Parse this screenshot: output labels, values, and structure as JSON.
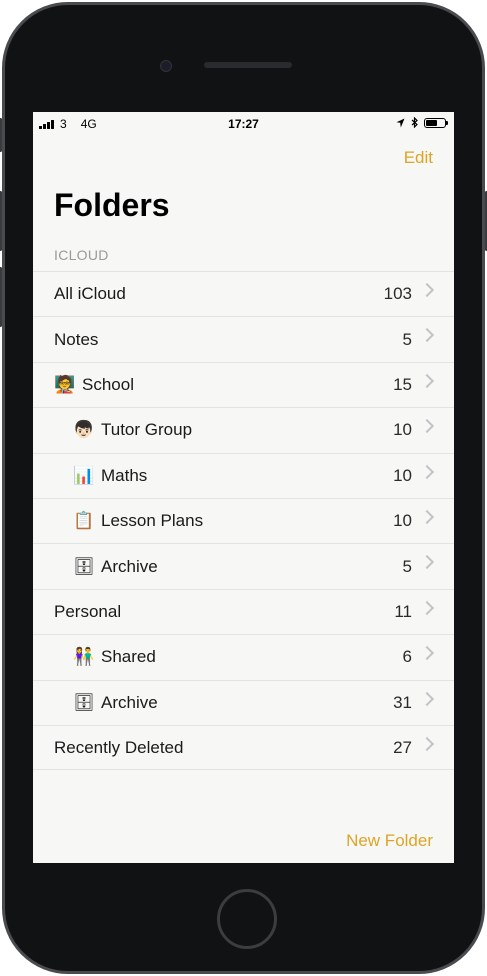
{
  "status": {
    "carrier": "3",
    "network": "4G",
    "time": "17:27"
  },
  "nav": {
    "edit": "Edit"
  },
  "page": {
    "title": "Folders",
    "section": "ICLOUD"
  },
  "folders": [
    {
      "label": "All iCloud",
      "count": "103",
      "icon": "",
      "level": 0
    },
    {
      "label": "Notes",
      "count": "5",
      "icon": "",
      "level": 0
    },
    {
      "label": "School",
      "count": "15",
      "icon": "🧑‍🏫",
      "level": 0
    },
    {
      "label": "Tutor Group",
      "count": "10",
      "icon": "👦🏻",
      "level": 1
    },
    {
      "label": "Maths",
      "count": "10",
      "icon": "📊",
      "level": 1
    },
    {
      "label": "Lesson Plans",
      "count": "10",
      "icon": "📋",
      "level": 1
    },
    {
      "label": "Archive",
      "count": "5",
      "icon": "🗄",
      "level": 1
    },
    {
      "label": "Personal",
      "count": "11",
      "icon": "",
      "level": 0
    },
    {
      "label": "Shared",
      "count": "6",
      "icon": "👫",
      "level": 1
    },
    {
      "label": "Archive",
      "count": "31",
      "icon": "🗄",
      "level": 1
    },
    {
      "label": "Recently Deleted",
      "count": "27",
      "icon": "",
      "level": 0
    }
  ],
  "footer": {
    "new_folder": "New Folder"
  },
  "colors": {
    "accent": "#dca526",
    "background": "#f7f7f6"
  },
  "battery_level": 0.6
}
